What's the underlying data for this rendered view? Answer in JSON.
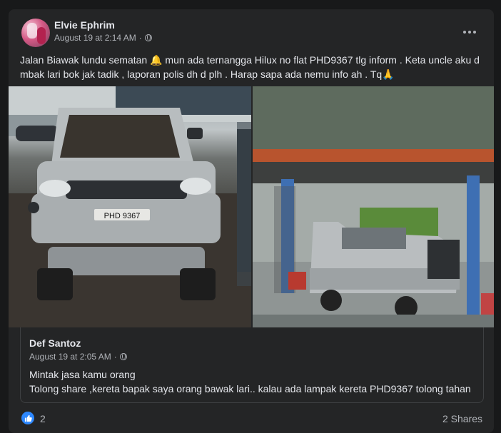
{
  "post": {
    "author": "Elvie Ephrim",
    "timestamp": "August 19 at 2:14 AM",
    "text_part1": "Jalan Biawak lundu sematan ",
    "bell_emoji": "🔔",
    "text_part2": " mun ada ternangga Hilux no flat PHD9367 tlg inform . Keta uncle aku  d mbak lari bok jak tadik , laporan polis dh d plh . Harap sapa ada nemu info ah . Tq",
    "pray_emoji": "🙏",
    "photo_left_plate": "PHD 9367",
    "more_icon": "more-options-icon",
    "privacy_icon": "globe-icon"
  },
  "shared": {
    "author": "Def Santoz",
    "timestamp": "August 19 at 2:05 AM",
    "line1": "Mintak jasa kamu orang",
    "line2": "Tolong share ,kereta bapak saya orang bawak lari.. kalau ada lampak kereta PHD9367 tolong tahan"
  },
  "footer": {
    "reactions": "2",
    "shares": "2 Shares",
    "reaction_icon": "like-icon"
  },
  "colors": {
    "background": "#18191a",
    "card": "#242526",
    "text": "#e4e6eb",
    "secondary_text": "#b0b3b8",
    "like_blue": "#2d88ff"
  }
}
